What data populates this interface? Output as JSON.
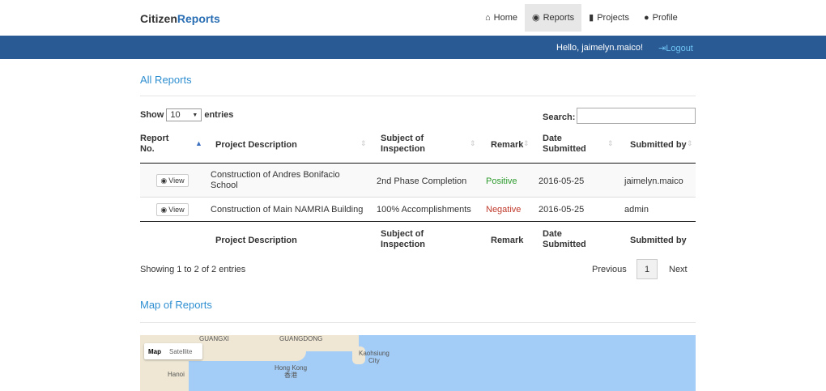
{
  "brand": {
    "part1": "Citizen",
    "part2": "Reports"
  },
  "nav": {
    "home": "Home",
    "reports": "Reports",
    "projects": "Projects",
    "profile": "Profile"
  },
  "user_bar": {
    "greeting": "Hello, jaimelyn.maico!",
    "logout": "Logout"
  },
  "reports_section": {
    "title": "All Reports"
  },
  "table_controls": {
    "show": "Show",
    "entries_value": "10",
    "entries": "entries",
    "search_label": "Search:",
    "search_value": ""
  },
  "table": {
    "headers": {
      "report_no_1": "Report",
      "report_no_2": "No.",
      "project": "Project Description",
      "subject_1": "Subject of",
      "subject_2": "Inspection",
      "remark": "Remark",
      "date_1": "Date",
      "date_2": "Submitted",
      "submitted_by": "Submitted by"
    },
    "rows": [
      {
        "action": "View",
        "project_1": "Construction of Andres Bonifacio",
        "project_2": "School",
        "subject": "2nd Phase Completion",
        "remark": "Positive",
        "date": "2016-05-25",
        "submitted_by": "jaimelyn.maico"
      },
      {
        "action": "View",
        "project_1": "Construction of Main NAMRIA Building",
        "subject": "100% Accomplishments",
        "remark": "Negative",
        "date": "2016-05-25",
        "submitted_by": "admin"
      }
    ]
  },
  "pagination": {
    "info": "Showing 1 to 2 of 2 entries",
    "previous": "Previous",
    "page": "1",
    "next": "Next"
  },
  "map_section": {
    "title": "Map of Reports",
    "type_map": "Map",
    "type_satellite": "Satellite",
    "labels": {
      "guangxi": "GUANGXI",
      "guangdong": "GUANGDONG",
      "kaohsiung_1": "Kaohsiung",
      "kaohsiung_2": "City",
      "hongkong_1": "Hong Kong",
      "hongkong_2": "香港",
      "hanoi": "Hanoi"
    }
  },
  "colors": {
    "bluebar": "#2a5a93",
    "link": "#2f8fd1",
    "positive": "#2e9c2e",
    "negative": "#c0392b",
    "sea": "#a3ccf6"
  },
  "icons": [
    "home-icon",
    "eye-icon",
    "file-icon",
    "user-icon",
    "logout-icon",
    "sort-icon"
  ]
}
